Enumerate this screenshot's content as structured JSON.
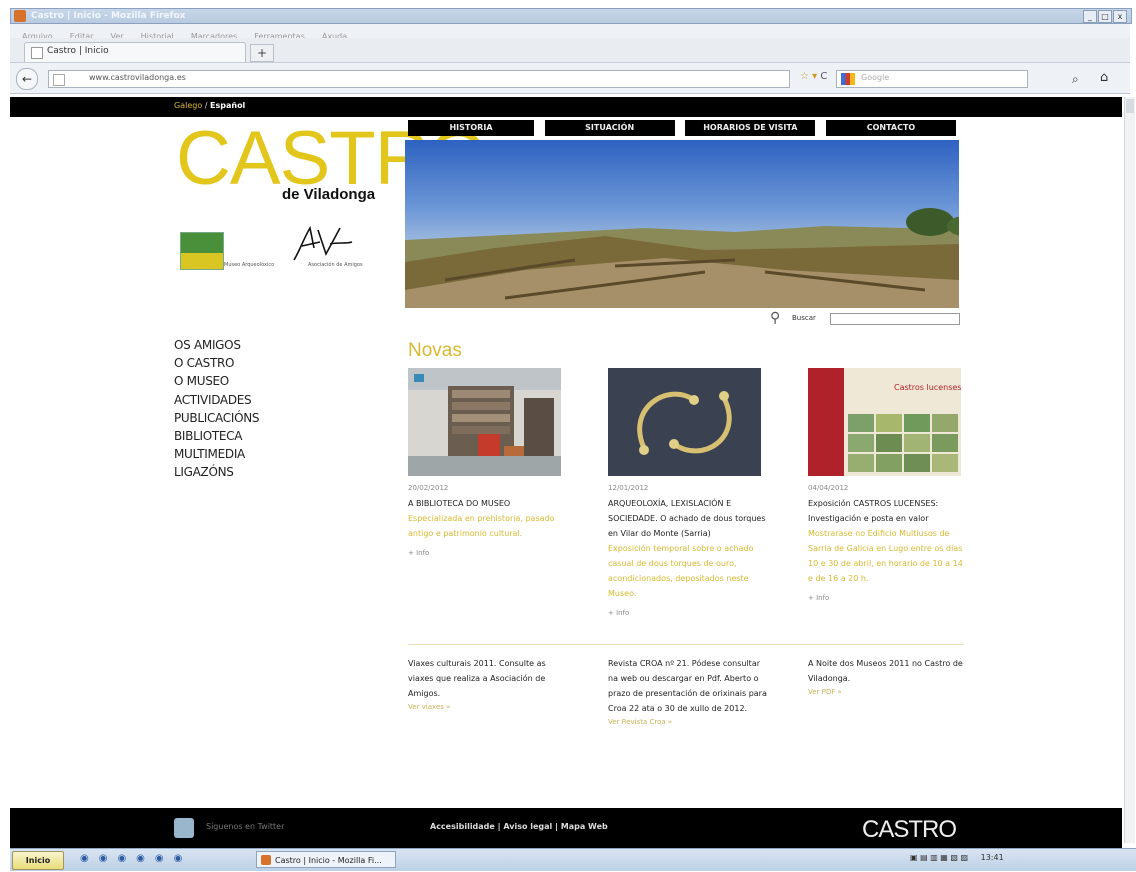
{
  "browser": {
    "window_title": "Castro | Inicio - Mozilla Firefox",
    "menu": [
      "Arquivo",
      "Editar",
      "Ver",
      "Historial",
      "Marcadores",
      "Ferramentas",
      "Axuda"
    ],
    "tab_label": "Castro | Inicio",
    "new_tab_label": "+",
    "url": "www.castroviladonga.es",
    "search_placeholder": "Google",
    "window_buttons": [
      "_",
      "□",
      "x"
    ]
  },
  "page": {
    "lang": {
      "gallego": "Galego",
      "sep": "/",
      "espanol": "Español"
    },
    "logo": {
      "main": "CASTRO",
      "sub": "de Viladonga"
    },
    "museum_caption": "Museo Arqueolóxico",
    "assoc_caption": "Asociación de Amigos",
    "top_nav": [
      "HISTORIA",
      "SITUACIÓN",
      "HORARIOS DE VISITA",
      "CONTACTO"
    ],
    "search_label": "Buscar",
    "side_menu": [
      "OS AMIGOS",
      "O CASTRO",
      "O MUSEO",
      "ACTIVIDADES",
      "PUBLICACIÓNS",
      "BIBLIOTECA",
      "MULTIMEDIA",
      "LIGAZÓNS"
    ],
    "news_heading": "Novas",
    "news": [
      {
        "date": "20/02/2012",
        "title": "A BIBLIOTECA DO MUSEO",
        "desc": "Especializada en prehistoria, pasado antigo e patrimonio cultural.",
        "more": "+ Info"
      },
      {
        "date": "12/01/2012",
        "title": "ARQUEOLOXÍA, LEXISLACIÓN E SOCIEDADE. O achado de dous torques en Vilar do Monte (Sarria)",
        "desc": "Exposición temporal sobre o achado casual de dous torques de ouro, acondicionados, depositados neste Museo.",
        "more": "+ Info"
      },
      {
        "date": "04/04/2012",
        "title": "Exposición CASTROS LUCENSES: Investigación e posta en valor",
        "desc": "Mostrarase no Edificio Multiusos de Sarria de Galicia en Lugo entre os días 10 e 30 de abril, en horario de 10 a 14 e de 16 a 20 h.",
        "more": "+ Info",
        "poster_title": "Castros lucenses"
      }
    ],
    "lower": [
      {
        "text": "Viaxes culturais 2011. Consulte as viaxes que realiza a Asociación de Amigos.",
        "more": "Ver viaxes »"
      },
      {
        "text": "Revista CROA nº 21. Pódese consultar na web ou descargar en Pdf. Aberto o prazo de presentación de orixinais para Croa 22 ata o 30 de xullo de 2012.",
        "more": "Ver Revista Croa »"
      },
      {
        "text": "A Noite dos Museos 2011 no Castro de Viladonga.",
        "more": "Ver PDF »"
      }
    ],
    "footer": {
      "twitter": "Síguenos en Twitter",
      "links": "Accesibilidade | Aviso legal | Mapa Web",
      "logo": "CASTRO"
    }
  },
  "taskbar": {
    "start": "Inicio",
    "firefox_button": "Castro | Inicio - Mozilla Fi...",
    "clock": "13:41"
  },
  "colors": {
    "accent": "#d8b930",
    "black": "#000000"
  }
}
